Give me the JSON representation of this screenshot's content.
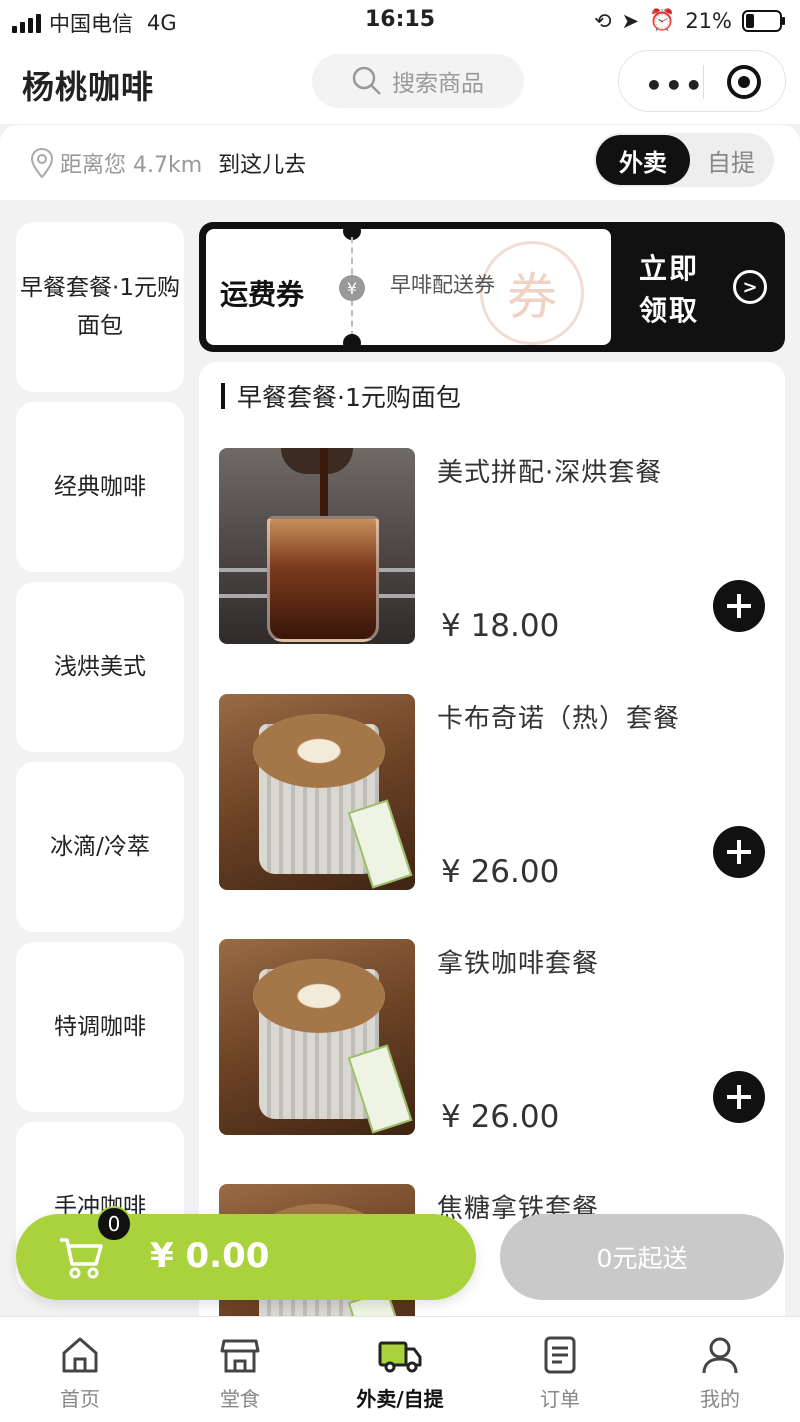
{
  "status_bar": {
    "carrier": "中国电信",
    "network": "4G",
    "time": "16:15",
    "battery": "21%"
  },
  "header": {
    "title": "杨桃咖啡",
    "search_placeholder": "搜索商品"
  },
  "location": {
    "distance_text": "距离您 4.7km",
    "navigate_label": "到这儿去"
  },
  "mode_toggle": {
    "delivery": "外卖",
    "pickup": "自提",
    "active": "delivery"
  },
  "categories": [
    {
      "label": "早餐套餐·1元购面包"
    },
    {
      "label": "经典咖啡"
    },
    {
      "label": "浅烘美式"
    },
    {
      "label": "冰滴/冷萃"
    },
    {
      "label": "特调咖啡"
    },
    {
      "label": "手冲咖啡"
    }
  ],
  "coupon": {
    "title": "运费券",
    "yen_symbol": "¥",
    "subtitle": "早啡配送券",
    "stamp": "券",
    "claim_line1": "立即",
    "claim_line2": "领取"
  },
  "section": {
    "title": "早餐套餐·1元购面包"
  },
  "products": [
    {
      "name": "美式拼配·深烘套餐",
      "price": "¥ 18.00",
      "image": "iced-americano"
    },
    {
      "name": "卡布奇诺（热）套餐",
      "price": "¥ 26.00",
      "image": "latte-cup"
    },
    {
      "name": "拿铁咖啡套餐",
      "price": "¥ 26.00",
      "image": "latte-cup"
    },
    {
      "name": "焦糖拿铁套餐",
      "price": "",
      "image": "latte-cup"
    }
  ],
  "cart": {
    "count": "0",
    "total": "¥ 0.00"
  },
  "checkout": {
    "label": "0元起送"
  },
  "tabs": [
    {
      "label": "首页",
      "icon": "home-icon"
    },
    {
      "label": "堂食",
      "icon": "store-icon"
    },
    {
      "label": "外卖/自提",
      "icon": "delivery-truck-icon"
    },
    {
      "label": "订单",
      "icon": "order-list-icon"
    },
    {
      "label": "我的",
      "icon": "user-icon"
    }
  ],
  "colors": {
    "accent": "#a9d23c",
    "dark": "#111111",
    "disabled": "#c9c9c9"
  }
}
